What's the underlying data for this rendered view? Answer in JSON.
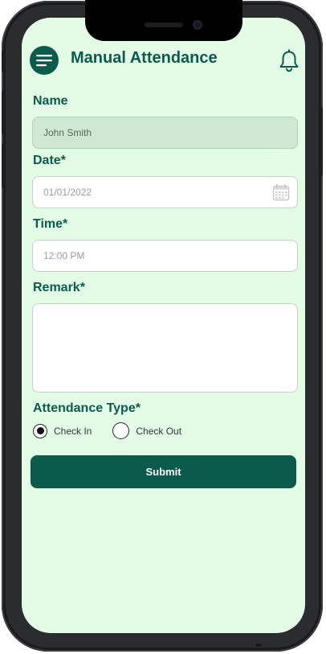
{
  "header": {
    "title": "Manual Attendance",
    "menu_icon": "hamburger-menu-icon",
    "notification_icon": "bell-icon"
  },
  "form": {
    "name": {
      "label": "Name",
      "value": "John Smith"
    },
    "date": {
      "label": "Date*",
      "placeholder": "01/01/2022",
      "icon": "calendar-icon"
    },
    "time": {
      "label": "Time*",
      "placeholder": "12:00 PM"
    },
    "remark": {
      "label": "Remark*",
      "value": ""
    },
    "attendance_type": {
      "label": "Attendance Type*",
      "options": [
        {
          "label": "Check In",
          "selected": true
        },
        {
          "label": "Check Out",
          "selected": false
        }
      ]
    },
    "submit_label": "Submit"
  },
  "colors": {
    "brand": "#0b5b4c",
    "screen_background": "#e3fce5",
    "name_field_background": "#cfe8d3"
  }
}
